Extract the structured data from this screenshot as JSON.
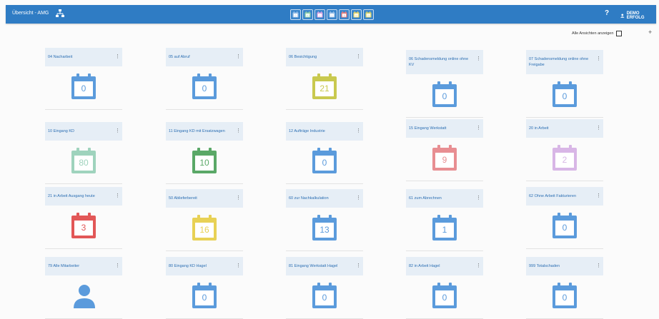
{
  "header": {
    "title": "Übersicht - AMG",
    "help": "?",
    "user": "DEMO ERFOLG"
  },
  "quick_views": [
    {
      "num": "0",
      "color": "#9ac0e8"
    },
    {
      "num": "10",
      "color": "#8fcfa8"
    },
    {
      "num": "2",
      "color": "#d6a3e0"
    },
    {
      "num": "1",
      "color": "#9ac0e8"
    },
    {
      "num": "3",
      "color": "#e87b7b"
    },
    {
      "num": "16",
      "color": "#e8d66a"
    },
    {
      "num": "21",
      "color": "#d8d166"
    }
  ],
  "toolbar": {
    "all_views_label": "Alle Ansichten anzeigen",
    "add": "+"
  },
  "cards": [
    {
      "label": "04 Nacharbeit",
      "count": "0",
      "color": "#5b9bdc",
      "icon": "calendar-icon"
    },
    {
      "label": "05 auf Abruf",
      "count": "0",
      "color": "#5b9bdc",
      "icon": "calendar-icon"
    },
    {
      "label": "06 Besichtigung",
      "count": "21",
      "color": "#c9c94f",
      "icon": "calendar-icon"
    },
    {
      "label": "06 Schadensmeldung online ohne KV",
      "count": "0",
      "color": "#5b9bdc",
      "icon": "calendar-icon"
    },
    {
      "label": "07 Schadensmeldung online ohne Freigabe",
      "count": "0",
      "color": "#5b9bdc",
      "icon": "calendar-icon"
    },
    {
      "label": "10 Eingang KD",
      "count": "80",
      "color": "#9fd3bd",
      "icon": "calendar-icon"
    },
    {
      "label": "11 Eingang KD mit Ersatzwagen",
      "count": "10",
      "color": "#5aa867",
      "icon": "calendar-icon"
    },
    {
      "label": "12 Aufträge Industrie",
      "count": "0",
      "color": "#5b9bdc",
      "icon": "calendar-icon"
    },
    {
      "label": "15 Eingang Werkstatt",
      "count": "9",
      "color": "#e88e92",
      "icon": "calendar-icon"
    },
    {
      "label": "20 in Arbeit",
      "count": "2",
      "color": "#d8b6e6",
      "icon": "calendar-icon"
    },
    {
      "label": "21 in Arbeit Ausgang heute",
      "count": "3",
      "color": "#e25757",
      "icon": "calendar-icon"
    },
    {
      "label": "50 Abliefer­bereit",
      "count": "16",
      "color": "#e8d155",
      "icon": "calendar-icon"
    },
    {
      "label": "60 zur Nachkalkulation",
      "count": "13",
      "color": "#5b9bdc",
      "icon": "calendar-icon"
    },
    {
      "label": "61 zum Abrechnen",
      "count": "1",
      "color": "#5b9bdc",
      "icon": "calendar-icon"
    },
    {
      "label": "62 Ohne Arbeit Fakturieren",
      "count": "0",
      "color": "#5b9bdc",
      "icon": "calendar-icon"
    },
    {
      "label": "79 Alle Mitarbeiter",
      "count": "",
      "color": "#5b9bdc",
      "icon": "person-icon"
    },
    {
      "label": "80 Eingang KD Hagel",
      "count": "0",
      "color": "#5b9bdc",
      "icon": "calendar-icon"
    },
    {
      "label": "81 Eingang Werkstatt Hagel",
      "count": "0",
      "color": "#5b9bdc",
      "icon": "calendar-icon"
    },
    {
      "label": "82 in Arbeit Hagel",
      "count": "0",
      "color": "#5b9bdc",
      "icon": "calendar-icon"
    },
    {
      "label": "999 Totalschaden",
      "count": "0",
      "color": "#5b9bdc",
      "icon": "calendar-icon"
    }
  ]
}
